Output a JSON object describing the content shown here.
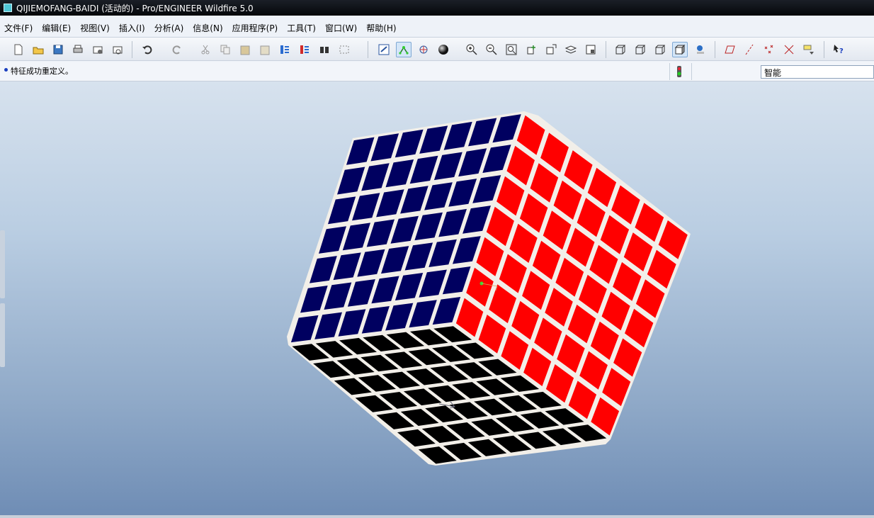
{
  "window": {
    "title": "QIJIEMOFANG-BAIDI (活动的) - Pro/ENGINEER Wildfire 5.0"
  },
  "menu": [
    "文件(F)",
    "编辑(E)",
    "视图(V)",
    "插入(I)",
    "分析(A)",
    "信息(N)",
    "应用程序(P)",
    "工具(T)",
    "窗口(W)",
    "帮助(H)"
  ],
  "toolbar": {
    "file": [
      "new-file-icon",
      "open-folder-icon",
      "save-icon",
      "print-icon",
      "send-mail-icon",
      "mail-attach-icon"
    ],
    "edit": [
      "undo-icon",
      "redo-icon",
      "cut-icon",
      "copy-icon",
      "paste-icon",
      "paste-special-icon",
      "regenerate-icon",
      "regen-manager-icon",
      "find-icon",
      "select-box-icon"
    ],
    "view": [
      "redraw-icon",
      "spin-center-icon",
      "orient-icon",
      "appearance-icon",
      "zoom-in-icon",
      "zoom-out-icon",
      "refit-icon",
      "reorient-icon",
      "saved-views-icon",
      "layers-icon",
      "view-manager-icon"
    ],
    "display": [
      "wireframe-icon",
      "hidden-line-icon",
      "no-hidden-icon",
      "shading-icon",
      "enhanced-realism-icon"
    ],
    "datum": [
      "datum-planes-icon",
      "datum-axes-icon",
      "datum-points-icon",
      "coord-systems-icon",
      "annotations-icon"
    ],
    "help": "context-help-icon"
  },
  "status": {
    "message": "特征成功重定义。"
  },
  "filter": {
    "value": "智能"
  },
  "colors": {
    "top_face": "#000060",
    "right_face": "#ff0000",
    "bottom_face": "#000000",
    "gap": "#f2efe9"
  }
}
